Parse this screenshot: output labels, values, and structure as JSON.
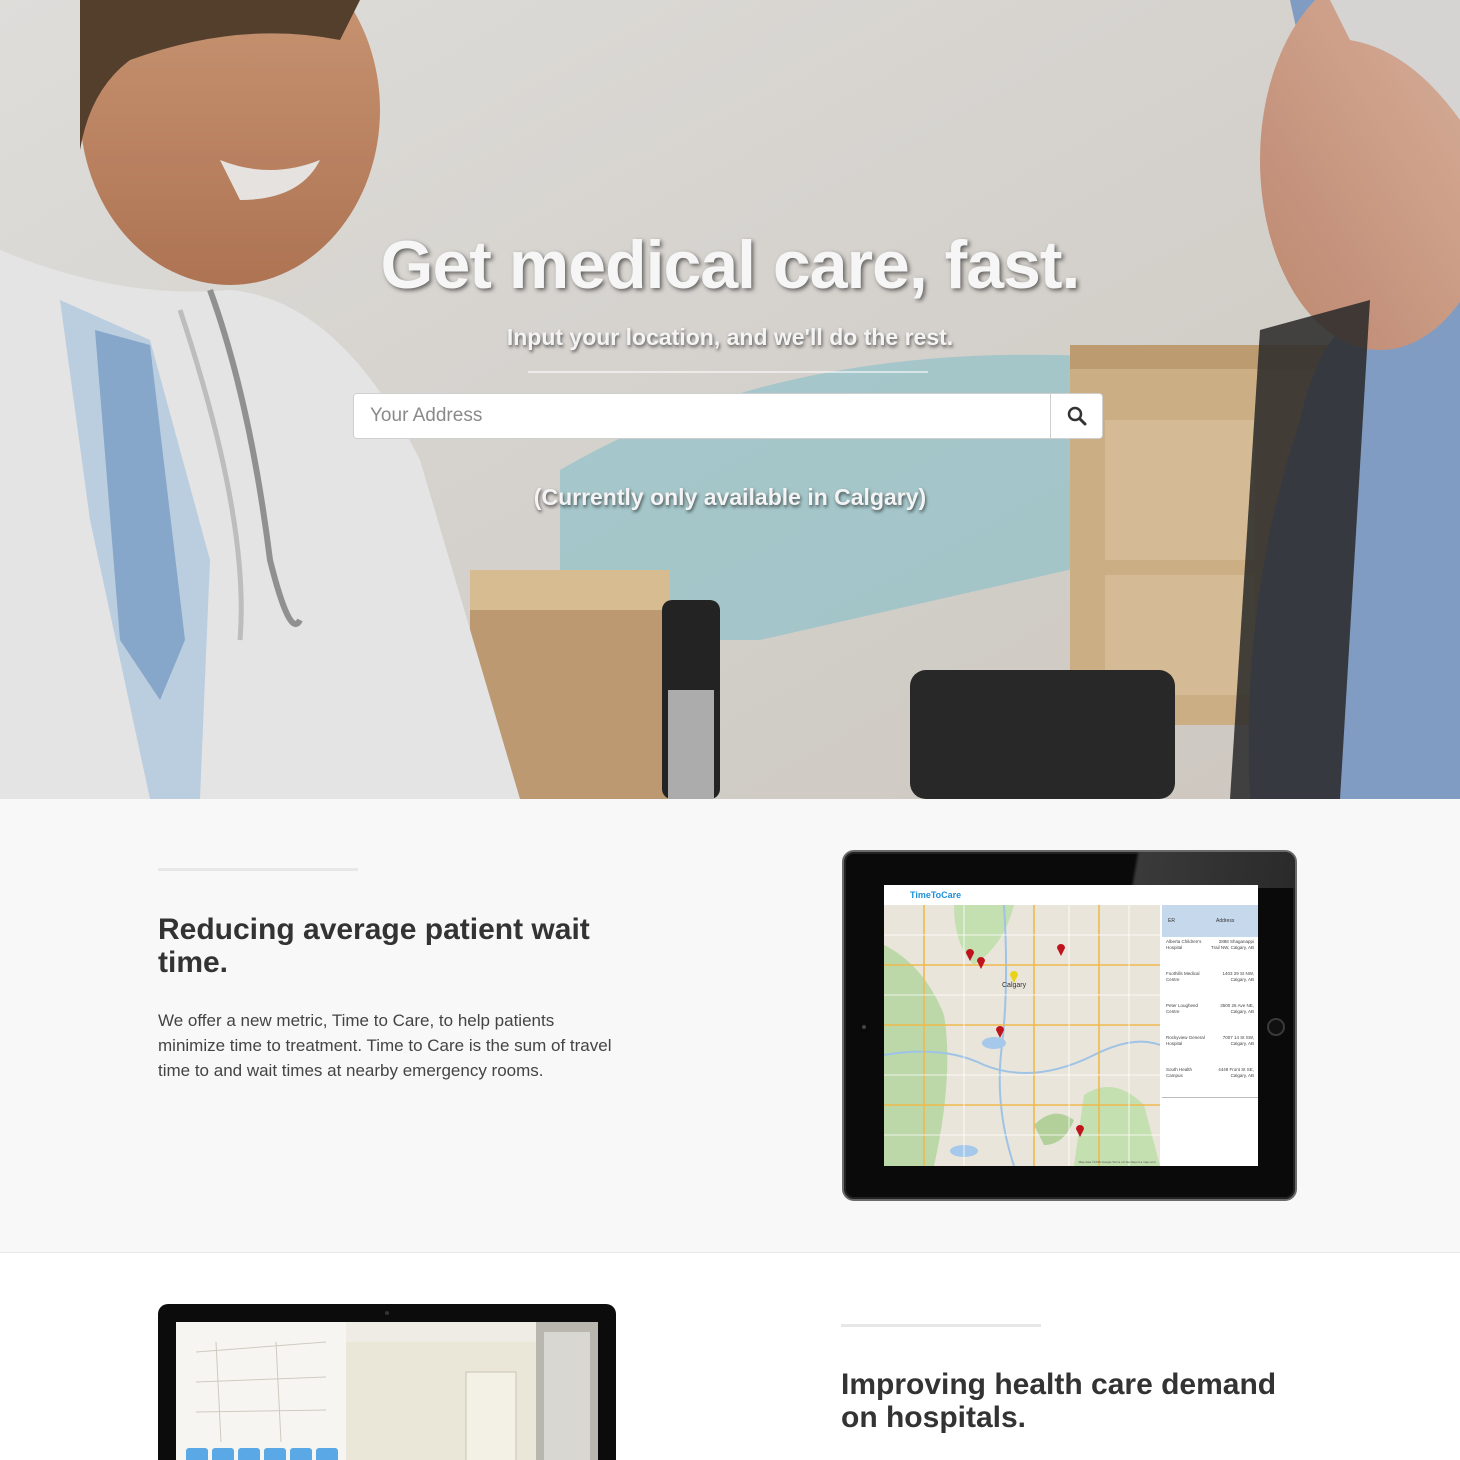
{
  "hero": {
    "title": "Get medical care, fast.",
    "subtitle": "Input your location, and we'll do the rest.",
    "search": {
      "placeholder": "Your Address",
      "value": "",
      "button_icon": "search-icon"
    },
    "note": "(Currently only available in Calgary)"
  },
  "features": [
    {
      "heading": "Reducing average patient wait time.",
      "text": "We offer a new metric, Time to Care, to help patients minimize time to treatment. Time to Care is the sum of travel time to and wait times at nearby emergency rooms."
    },
    {
      "heading": "Improving health care demand on hospitals."
    }
  ],
  "tablet_app": {
    "brand": "TimeToCare",
    "city_label": "Calgary",
    "table_headers": [
      "ER",
      "Address"
    ],
    "rows": [
      {
        "name": "Alberta Children's Hospital",
        "address": "2888 Shaganappi Trail NW, Calgary, AB"
      },
      {
        "name": "Foothills Medical Centre",
        "address": "1403 29 St NW, Calgary, AB"
      },
      {
        "name": "Peter Lougheed Centre",
        "address": "3500 26 Ave NE, Calgary, AB"
      },
      {
        "name": "Rockyview General Hospital",
        "address": "7007 14 St SW, Calgary, AB"
      },
      {
        "name": "South Health Campus",
        "address": "4448 Front St SE, Calgary, AB"
      }
    ],
    "map_attribution": "Map data ©2016 Google  Terms of Use  Report a map error"
  },
  "colors": {
    "accent_blue": "#1e90d8",
    "marker_red": "#c0141c",
    "marker_yellow": "#e8d21a",
    "section_bg": "#f8f8f8"
  }
}
